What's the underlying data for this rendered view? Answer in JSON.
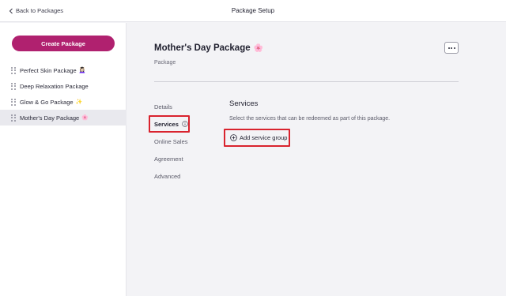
{
  "header": {
    "back_label": "Back to Packages",
    "title": "Package Setup"
  },
  "sidebar": {
    "create_label": "Create Package",
    "items": [
      {
        "label": "Perfect Skin Package",
        "emoji": "💆🏻‍♀️"
      },
      {
        "label": "Deep Relaxation Package",
        "emoji": ""
      },
      {
        "label": "Glow & Go Package",
        "emoji": "✨"
      },
      {
        "label": "Mother's Day Package",
        "emoji": "🌸"
      }
    ],
    "active_index": 3
  },
  "main": {
    "title": "Mother's Day Package",
    "title_emoji": "🌸",
    "subtitle": "Package",
    "subnav": [
      {
        "label": "Details"
      },
      {
        "label": "Services"
      },
      {
        "label": "Online Sales"
      },
      {
        "label": "Agreement"
      },
      {
        "label": "Advanced"
      }
    ],
    "section": {
      "title": "Services",
      "description": "Select the services that can be redeemed as part of this package.",
      "add_label": "Add service group"
    }
  },
  "colors": {
    "brand": "#b0216f",
    "highlight": "#d9232e"
  }
}
